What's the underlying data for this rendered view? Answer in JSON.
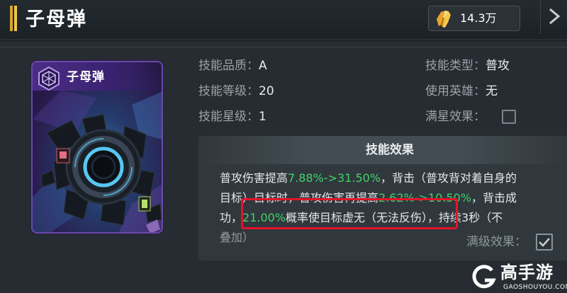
{
  "header": {
    "title": "子母弹",
    "currency": {
      "icon": "gold-crystal-icon",
      "value": "14.3万"
    },
    "close_icon": "close-chevron-icon"
  },
  "skill_card": {
    "name": "子母弹",
    "emblem_icon": "hexagon-emblem-icon",
    "art": "cluster-bomb-art"
  },
  "attributes": {
    "quality": {
      "label": "技能品质：",
      "value": "A"
    },
    "level": {
      "label": "技能等级：",
      "value": "20"
    },
    "star": {
      "label": "技能星级：",
      "value": "1"
    },
    "type": {
      "label": "技能类型：",
      "value": "普攻"
    },
    "hero": {
      "label": "使用英雄：",
      "value": "无"
    },
    "full_star": {
      "label": "满星效果：",
      "checked": false
    }
  },
  "effect": {
    "title": "技能效果",
    "line1_a": "普攻伤害提高",
    "line1_hl": "7.88%->31.50%",
    "line1_b": "，背击（普攻背对着自身的",
    "line2_a": "目标）目标时，普攻伤害再提高",
    "line2_hl": "2.62%->10.50%",
    "line2_b": "，背击成",
    "line3_a": "功，",
    "line3_hl": "21.00%",
    "line3_b": "概率使目标虚无（无法反伤），持续3秒（不",
    "line4": "叠加）"
  },
  "max_level": {
    "label": "满级效果：",
    "checked": true
  },
  "watermark": {
    "text": "高手游",
    "sub": "GAOSHOUYOU.COM",
    "icon": "g-logo-icon"
  },
  "colors": {
    "highlight_green": "#3fd26a",
    "annotation_red": "#e3142a",
    "card_purple": "#6a4aa8",
    "title_gold": "#f2c548"
  }
}
